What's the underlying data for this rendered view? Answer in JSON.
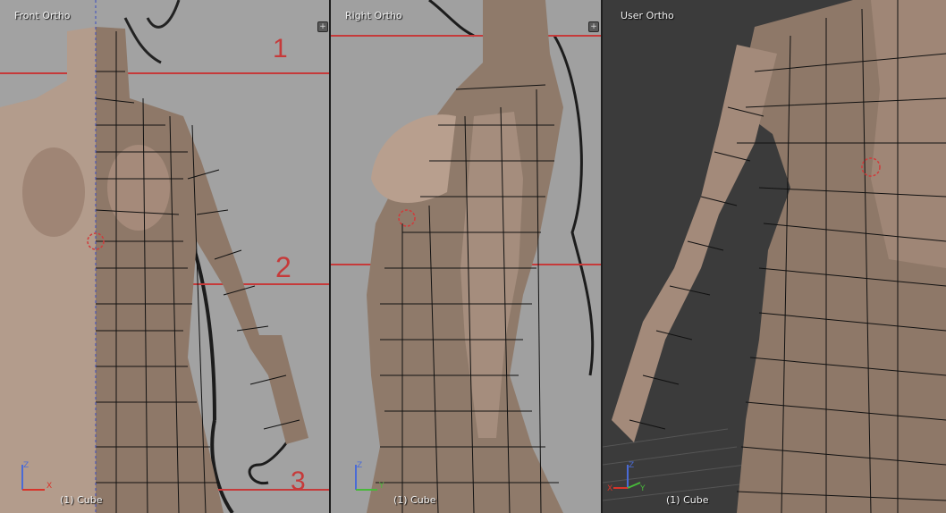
{
  "viewports": [
    {
      "title": "Front Ortho",
      "object": "(1) Cube",
      "corner_icon": "plus-icon"
    },
    {
      "title": "Right Ortho",
      "object": "(1) Cube",
      "corner_icon": "plus-icon"
    },
    {
      "title": "User Ortho",
      "object": "(1) Cube",
      "corner_icon": "plus-icon"
    }
  ],
  "reference_marks": [
    "1",
    "2",
    "3"
  ],
  "axes": {
    "x": "X",
    "y": "Y",
    "z": "Z"
  },
  "colors": {
    "background_grey": "#9c9c9c",
    "dark_grey": "#3b3b3b",
    "skin": "#a58f80",
    "guide_red": "#c63a3a",
    "axis_x": "#d8342a",
    "axis_y": "#48b83a",
    "axis_z": "#4a6bd6"
  }
}
